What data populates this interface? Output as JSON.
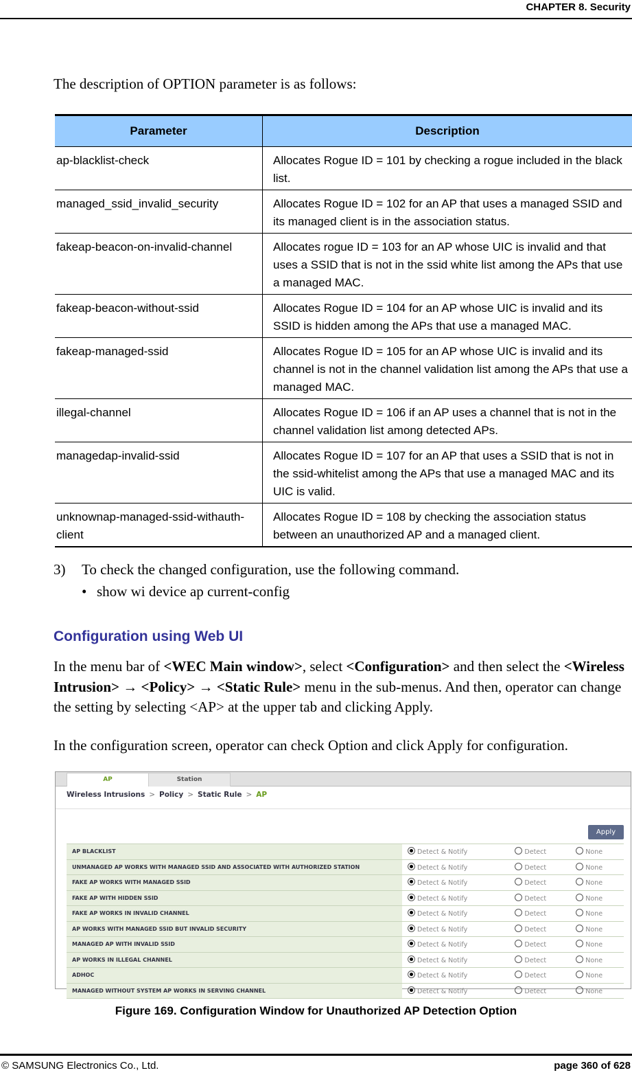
{
  "header": {
    "chapter": "CHAPTER 8. Security"
  },
  "intro": "The description of OPTION parameter is as follows:",
  "param_table": {
    "headers": [
      "Parameter",
      "Description"
    ],
    "rows": [
      {
        "param": "ap-blacklist-check",
        "desc": "Allocates Rogue ID = 101 by checking a rogue included in the black list."
      },
      {
        "param": "managed_ssid_invalid_security",
        "desc": "Allocates Rogue ID = 102 for an AP that uses a managed SSID and its managed client is in the association status."
      },
      {
        "param": "fakeap-beacon-on-invalid-channel",
        "desc": "Allocates rogue ID = 103 for an AP whose UIC is invalid and that uses a SSID that is not in the ssid white list among the APs that use a managed MAC."
      },
      {
        "param": "fakeap-beacon-without-ssid",
        "desc": "Allocates Rogue ID = 104 for an AP whose UIC is invalid and its SSID is hidden among the APs that use a managed MAC."
      },
      {
        "param": "fakeap-managed-ssid",
        "desc": "Allocates Rogue ID = 105 for an AP whose UIC is invalid and its channel is not in the channel validation list among the APs that use a managed MAC."
      },
      {
        "param": "illegal-channel",
        "desc": "Allocates Rogue ID = 106 if an AP uses a channel that is not in the channel validation list among detected APs."
      },
      {
        "param": "managedap-invalid-ssid",
        "desc": "Allocates Rogue ID = 107 for an AP that uses a SSID that is not in the ssid-whitelist among the APs that use a managed MAC and its UIC is valid."
      },
      {
        "param": "unknownap-managed-ssid-withauth-client",
        "desc": "Allocates Rogue ID = 108 by checking the association status between an unauthorized AP and a managed client."
      }
    ]
  },
  "step3": {
    "num": "3)",
    "text": "To check the changed configuration, use the following command.",
    "bullet": "•",
    "command": "show wi device ap current-config"
  },
  "section_title": "Configuration using Web UI",
  "para1": {
    "t1": "In the menu bar of ",
    "b1": "<WEC Main window>",
    "t2": ", select ",
    "b2": "<Configuration>",
    "t3": " and then select the ",
    "b3": "<Wireless Intrusion>",
    "arrow": " → ",
    "b4": "<Policy>",
    "b5": "<Static Rule>",
    "t4": " menu in the sub-menus. And then, operator can change the setting by selecting <AP> at the upper tab and clicking Apply."
  },
  "para2": "In the configuration screen, operator can check Option and click Apply for configuration.",
  "screenshot": {
    "tabs": [
      "AP",
      "Station"
    ],
    "breadcrumb": [
      "Wireless Intrusions",
      "Policy",
      "Static Rule",
      "AP"
    ],
    "breadcrumb_sep": ">",
    "apply_label": "Apply",
    "options": [
      "Detect & Notify",
      "Detect",
      "None"
    ],
    "rules": [
      {
        "label": "AP BLACKLIST",
        "selected": "Detect & Notify"
      },
      {
        "label": "UNMANAGED AP WORKS WITH MANAGED SSID AND ASSOCIATED WITH AUTHORIZED STATION",
        "selected": "Detect & Notify"
      },
      {
        "label": "FAKE AP WORKS WITH MANAGED SSID",
        "selected": "Detect & Notify"
      },
      {
        "label": "FAKE AP WITH HIDDEN SSID",
        "selected": "Detect & Notify"
      },
      {
        "label": "FAKE AP WORKS IN INVALID CHANNEL",
        "selected": "Detect & Notify"
      },
      {
        "label": "AP WORKS WITH MANAGED SSID BUT INVALID SECURITY",
        "selected": "Detect & Notify"
      },
      {
        "label": "MANAGED AP WITH INVALID SSID",
        "selected": "Detect & Notify"
      },
      {
        "label": "AP WORKS IN ILLEGAL CHANNEL",
        "selected": "Detect & Notify"
      },
      {
        "label": "ADHOC",
        "selected": "Detect & Notify"
      },
      {
        "label": "MANAGED WITHOUT SYSTEM AP WORKS IN SERVING CHANNEL",
        "selected": "Detect & Notify"
      }
    ]
  },
  "caption": "Figure 169. Configuration Window for Unauthorized AP Detection Option",
  "footer": {
    "left": "© SAMSUNG Electronics Co., Ltd.",
    "right": "page 360 of 628"
  }
}
